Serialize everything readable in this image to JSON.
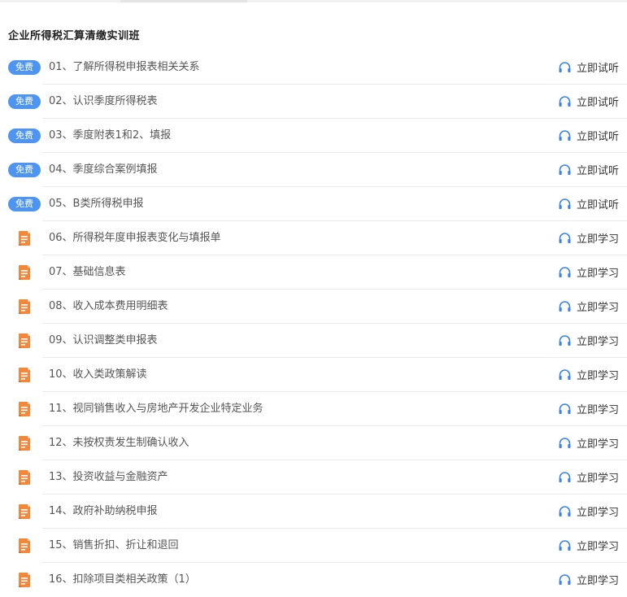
{
  "course": {
    "title": "企业所得税汇算清缴实训班"
  },
  "colors": {
    "free_badge": "#4d95f0",
    "doc_icon": "#f5873a",
    "headphone_icon": "#3a86e8"
  },
  "lessons": [
    {
      "title": "01、了解所得税申报表相关关系",
      "badge": "免费",
      "icon": "free-badge",
      "action": "立即试听"
    },
    {
      "title": "02、认识季度所得税表",
      "badge": "免费",
      "icon": "free-badge",
      "action": "立即试听"
    },
    {
      "title": "03、季度附表1和2、填报",
      "badge": "免费",
      "icon": "free-badge",
      "action": "立即试听"
    },
    {
      "title": "04、季度综合案例填报",
      "badge": "免费",
      "icon": "free-badge",
      "action": "立即试听"
    },
    {
      "title": "05、B类所得税申报",
      "badge": "免费",
      "icon": "free-badge",
      "action": "立即试听"
    },
    {
      "title": "06、所得税年度申报表变化与填报单",
      "badge": "",
      "icon": "document-icon",
      "action": "立即学习"
    },
    {
      "title": "07、基础信息表",
      "badge": "",
      "icon": "document-icon",
      "action": "立即学习"
    },
    {
      "title": "08、收入成本费用明细表",
      "badge": "",
      "icon": "document-icon",
      "action": "立即学习"
    },
    {
      "title": "09、认识调整类申报表",
      "badge": "",
      "icon": "document-icon",
      "action": "立即学习"
    },
    {
      "title": "10、收入类政策解读",
      "badge": "",
      "icon": "document-icon",
      "action": "立即学习"
    },
    {
      "title": "11、视同销售收入与房地产开发企业特定业务",
      "badge": "",
      "icon": "document-icon",
      "action": "立即学习"
    },
    {
      "title": "12、未按权责发生制确认收入",
      "badge": "",
      "icon": "document-icon",
      "action": "立即学习"
    },
    {
      "title": "13、投资收益与金融资产",
      "badge": "",
      "icon": "document-icon",
      "action": "立即学习"
    },
    {
      "title": "14、政府补助纳税申报",
      "badge": "",
      "icon": "document-icon",
      "action": "立即学习"
    },
    {
      "title": "15、销售折扣、折让和退回",
      "badge": "",
      "icon": "document-icon",
      "action": "立即学习"
    },
    {
      "title": "16、扣除项目类相关政策（1）",
      "badge": "",
      "icon": "document-icon",
      "action": "立即学习"
    }
  ]
}
